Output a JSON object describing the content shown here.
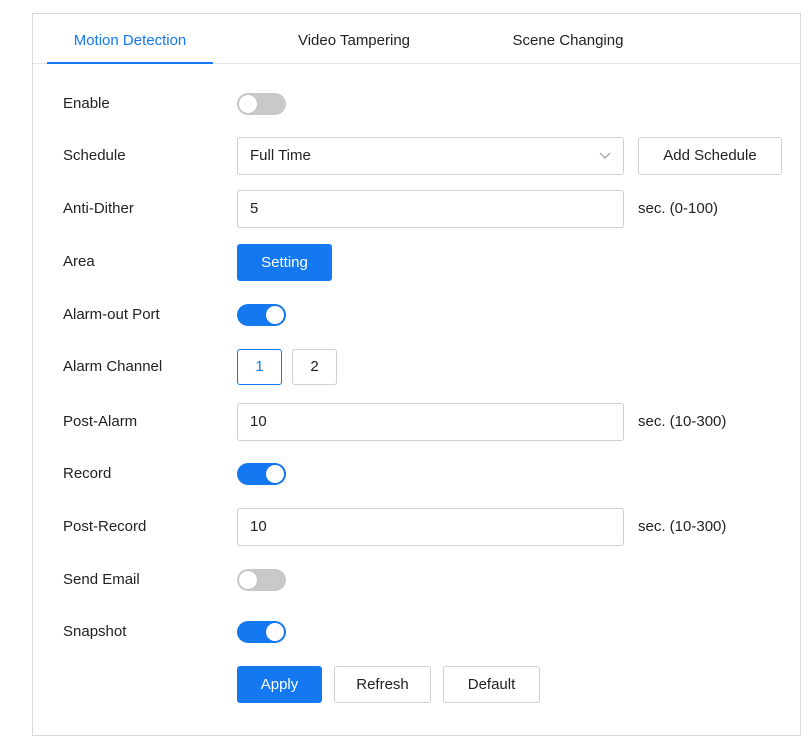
{
  "tabs": [
    {
      "label": "Motion Detection",
      "active": true
    },
    {
      "label": "Video Tampering",
      "active": false
    },
    {
      "label": "Scene Changing",
      "active": false
    }
  ],
  "form": {
    "enable": {
      "label": "Enable",
      "on": false
    },
    "schedule": {
      "label": "Schedule",
      "value": "Full Time",
      "add_label": "Add Schedule"
    },
    "anti_dither": {
      "label": "Anti-Dither",
      "value": "5",
      "unit": "sec. (0-100)"
    },
    "area": {
      "label": "Area",
      "button_label": "Setting"
    },
    "alarm_out_port": {
      "label": "Alarm-out Port",
      "on": true
    },
    "alarm_channel": {
      "label": "Alarm Channel",
      "options": [
        "1",
        "2"
      ],
      "selected": "1"
    },
    "post_alarm": {
      "label": "Post-Alarm",
      "value": "10",
      "unit": "sec. (10-300)"
    },
    "record": {
      "label": "Record",
      "on": true
    },
    "post_record": {
      "label": "Post-Record",
      "value": "10",
      "unit": "sec. (10-300)"
    },
    "send_email": {
      "label": "Send Email",
      "on": false
    },
    "snapshot": {
      "label": "Snapshot",
      "on": true
    }
  },
  "actions": {
    "apply_label": "Apply",
    "refresh_label": "Refresh",
    "default_label": "Default"
  },
  "colors": {
    "accent": "#1478f0",
    "toggle_off": "#c9c9c9",
    "border": "#cfcfcf"
  },
  "icons": {
    "schedule_dropdown": "chevron-down-icon"
  }
}
